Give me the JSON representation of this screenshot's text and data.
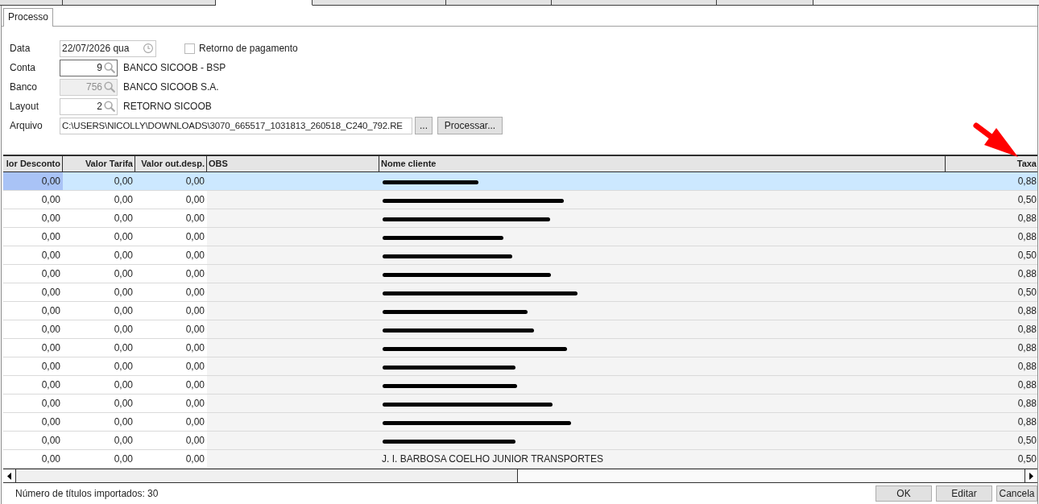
{
  "outer_tabs": [
    {
      "selected": false
    },
    {
      "selected": false
    },
    {
      "selected": true
    },
    {
      "selected": false
    },
    {
      "selected": false
    },
    {
      "selected": false
    },
    {
      "selected": false
    }
  ],
  "tabs": [
    {
      "label": "Processo",
      "selected": true
    }
  ],
  "form": {
    "date": {
      "label": "Data",
      "value": "22/07/2026 qua"
    },
    "payment_return": {
      "label": "Retorno de pagamento",
      "checked": false
    },
    "lookups": [
      {
        "label": "Conta",
        "value": "9",
        "description": "BANCO SICOOB - BSP",
        "focused": true,
        "disabled": false
      },
      {
        "label": "Banco",
        "value": "756",
        "description": "BANCO SICOOB S.A.",
        "focused": false,
        "disabled": true
      },
      {
        "label": "Layout",
        "value": "2",
        "description": "RETORNO SICOOB",
        "focused": false,
        "disabled": false
      }
    ],
    "file": {
      "label": "Arquivo",
      "value": "C:\\USERS\\NICOLLY\\DOWNLOADS\\3070_665517_1031813_260518_C240_792.RE",
      "browse_button": "...",
      "process_button": "Processar..."
    }
  },
  "table": {
    "columns": [
      "lor Desconto",
      "Valor Tarifa",
      "Valor out.desp.",
      "OBS",
      "Nome cliente",
      "Taxa"
    ],
    "rows": [
      {
        "valor_desconto": "0,00",
        "valor_tarifa": "0,00",
        "valor_out_desp": "0,00",
        "redacted": true,
        "taxa": "0,88",
        "selected": true,
        "focused": true
      },
      {
        "valor_desconto": "0,00",
        "valor_tarifa": "0,00",
        "valor_out_desp": "0,00",
        "redacted": true,
        "taxa": "0,50",
        "selected": false,
        "focused": false
      },
      {
        "valor_desconto": "0,00",
        "valor_tarifa": "0,00",
        "valor_out_desp": "0,00",
        "redacted": true,
        "taxa": "0,88",
        "selected": false,
        "focused": false
      },
      {
        "valor_desconto": "0,00",
        "valor_tarifa": "0,00",
        "valor_out_desp": "0,00",
        "redacted": true,
        "taxa": "0,88",
        "selected": false,
        "focused": false
      },
      {
        "valor_desconto": "0,00",
        "valor_tarifa": "0,00",
        "valor_out_desp": "0,00",
        "redacted": true,
        "taxa": "0,50",
        "selected": false,
        "focused": false
      },
      {
        "valor_desconto": "0,00",
        "valor_tarifa": "0,00",
        "valor_out_desp": "0,00",
        "redacted": true,
        "taxa": "0,88",
        "selected": false,
        "focused": false
      },
      {
        "valor_desconto": "0,00",
        "valor_tarifa": "0,00",
        "valor_out_desp": "0,00",
        "redacted": true,
        "taxa": "0,50",
        "selected": false,
        "focused": false
      },
      {
        "valor_desconto": "0,00",
        "valor_tarifa": "0,00",
        "valor_out_desp": "0,00",
        "redacted": true,
        "taxa": "0,88",
        "selected": false,
        "focused": false
      },
      {
        "valor_desconto": "0,00",
        "valor_tarifa": "0,00",
        "valor_out_desp": "0,00",
        "redacted": true,
        "taxa": "0,88",
        "selected": false,
        "focused": false
      },
      {
        "valor_desconto": "0,00",
        "valor_tarifa": "0,00",
        "valor_out_desp": "0,00",
        "redacted": true,
        "taxa": "0,88",
        "selected": false,
        "focused": false
      },
      {
        "valor_desconto": "0,00",
        "valor_tarifa": "0,00",
        "valor_out_desp": "0,00",
        "redacted": true,
        "taxa": "0,88",
        "selected": false,
        "focused": false
      },
      {
        "valor_desconto": "0,00",
        "valor_tarifa": "0,00",
        "valor_out_desp": "0,00",
        "redacted": true,
        "taxa": "0,88",
        "selected": false,
        "focused": false
      },
      {
        "valor_desconto": "0,00",
        "valor_tarifa": "0,00",
        "valor_out_desp": "0,00",
        "redacted": true,
        "taxa": "0,88",
        "selected": false,
        "focused": false
      },
      {
        "valor_desconto": "0,00",
        "valor_tarifa": "0,00",
        "valor_out_desp": "0,00",
        "redacted": true,
        "taxa": "0,88",
        "selected": false,
        "focused": false
      },
      {
        "valor_desconto": "0,00",
        "valor_tarifa": "0,00",
        "valor_out_desp": "0,00",
        "redacted": true,
        "taxa": "0,50",
        "selected": false,
        "focused": false
      },
      {
        "valor_desconto": "0,00",
        "valor_tarifa": "0,00",
        "valor_out_desp": "0,00",
        "redacted": false,
        "nome_cliente": "J. I. BARBOSA COELHO JUNIOR TRANSPORTES",
        "taxa": "0,50",
        "selected": false,
        "focused": false
      }
    ]
  },
  "status_bar": {
    "text": "Número de títulos importados: 30",
    "buttons": [
      "OK",
      "Editar",
      "Cancela"
    ]
  }
}
